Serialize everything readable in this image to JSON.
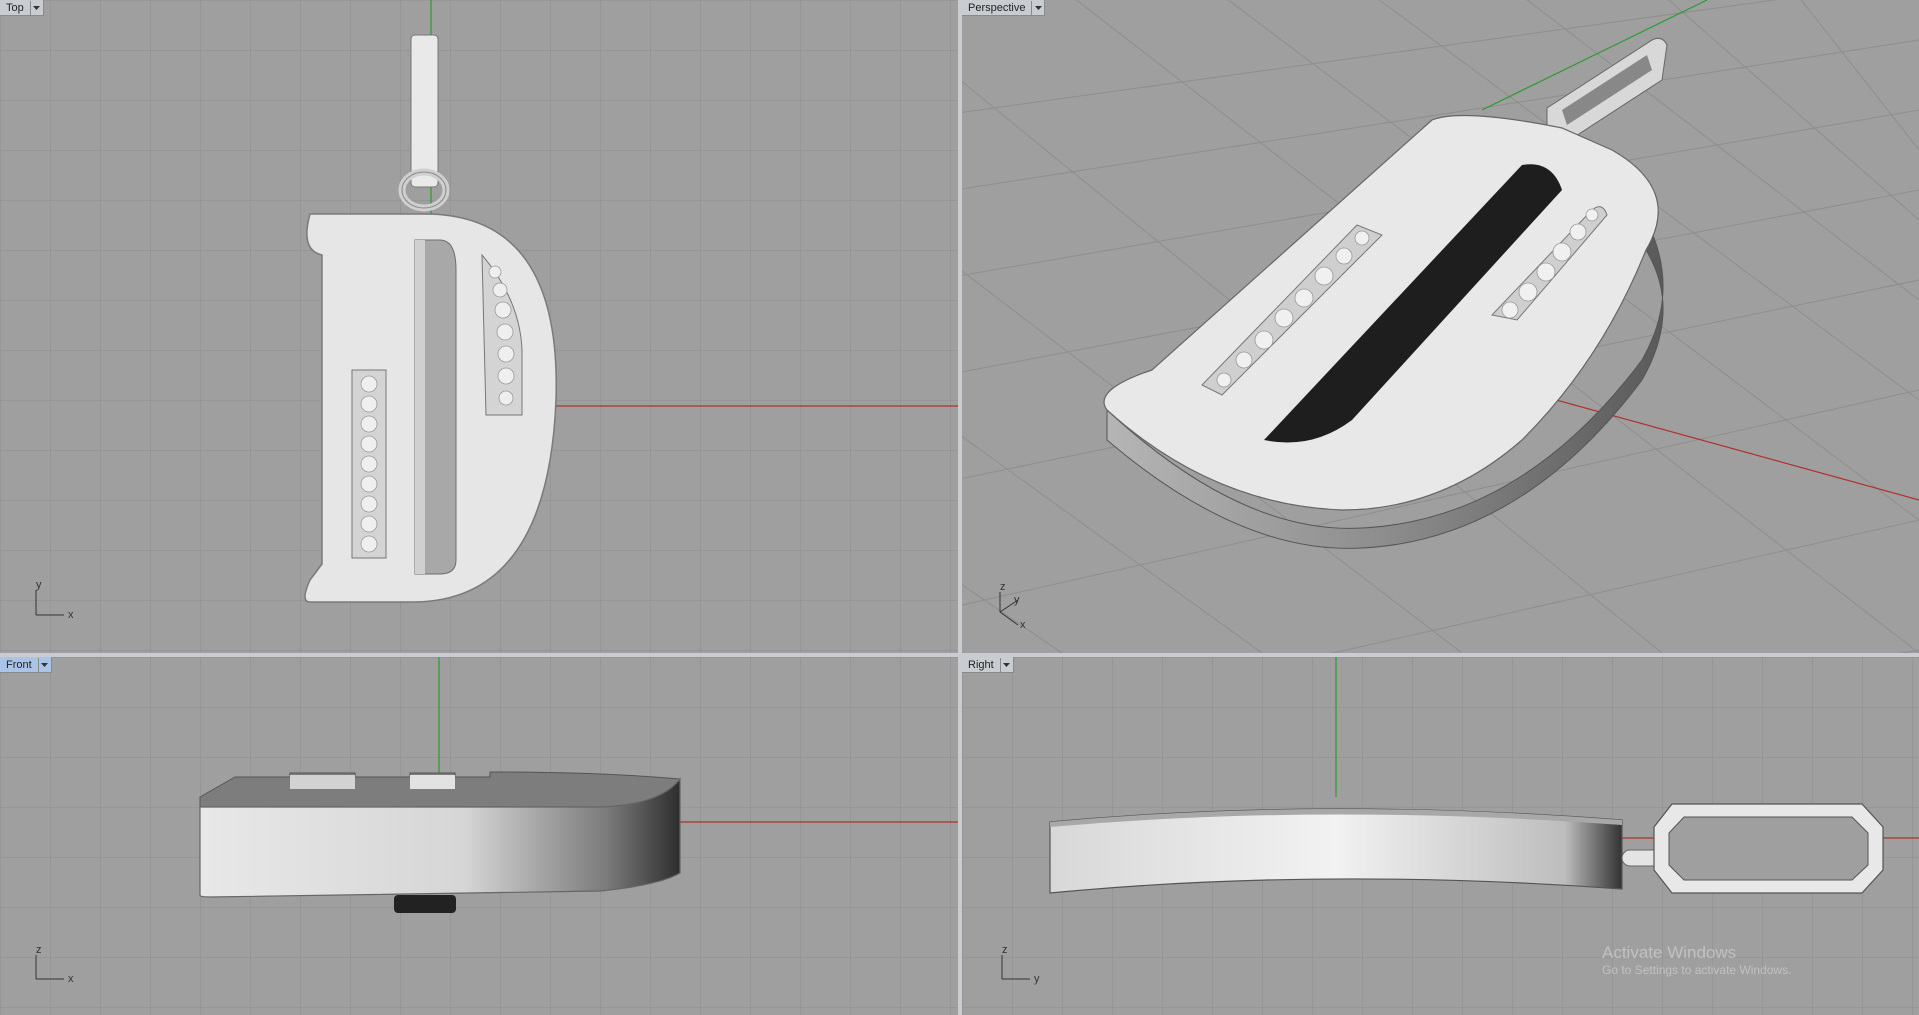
{
  "viewports": {
    "top": {
      "label": "Top"
    },
    "perspective": {
      "label": "Perspective"
    },
    "front": {
      "label": "Front"
    },
    "right": {
      "label": "Right"
    }
  },
  "active_viewport": "Front",
  "axes": {
    "top": {
      "a": "y",
      "b": "x"
    },
    "perspective": {
      "z": "z",
      "y": "y",
      "x": "x"
    },
    "front": {
      "a": "z",
      "b": "x"
    },
    "right": {
      "a": "z",
      "b": "y"
    }
  },
  "watermark": {
    "title": "Activate Windows",
    "subtitle": "Go to Settings to activate Windows."
  },
  "colors": {
    "viewport_bg": "#9f9f9f",
    "grid": "#8e8e8e",
    "grid_major": "#7c7c7c",
    "x_axis": "#b03030",
    "y_axis": "#2e9a2e",
    "active_tab": "#aac4e8",
    "divider": "#c9ccd0",
    "model": "#e6e6e6"
  },
  "icons": {
    "viewport_menu": "chevron-down-icon"
  }
}
